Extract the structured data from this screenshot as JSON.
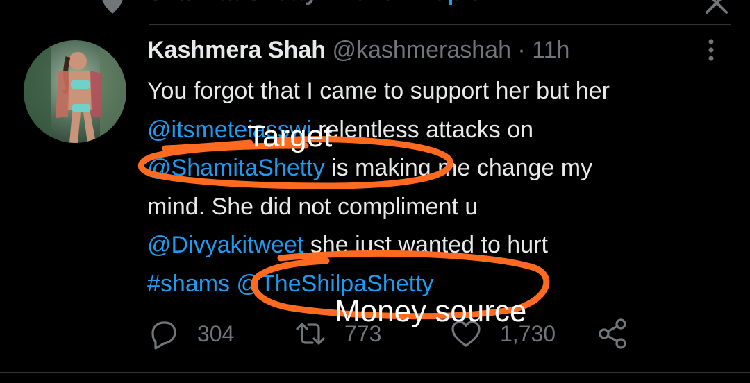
{
  "topic_bar": {
    "topic_name": "Shamita Shetty",
    "separator": " · ",
    "follow_label": "Follow Topic"
  },
  "tweet": {
    "author_name": "Kashmera Shah",
    "author_handle": "@kashmerashah",
    "dot": " · ",
    "time": "11h",
    "lines": [
      [
        {
          "t": "You forgot that I came to support her but her",
          "link": false
        }
      ],
      [
        {
          "t": "@itsmeteiasswi",
          "link": true
        },
        {
          "t": " relentless attacks on",
          "link": false
        }
      ],
      [
        {
          "t": "@ShamitaShetty",
          "link": true
        },
        {
          "t": " is making me change my",
          "link": false
        }
      ],
      [
        {
          "t": "mind. She did not compliment u",
          "link": false
        }
      ],
      [
        {
          "t": "@Divyakitweet",
          "link": true
        },
        {
          "t": " she just wanted to hurt",
          "link": false
        }
      ],
      [
        {
          "t": "#shams",
          "link": true
        },
        {
          "t": " ",
          "link": false
        },
        {
          "t": "@TheShilpaShetty",
          "link": true
        }
      ]
    ]
  },
  "actions": {
    "reply_count": "304",
    "retweet_count": "773",
    "like_count": "1,730"
  },
  "annotations": {
    "target_label": "Target",
    "money_label": "Money source",
    "scribble_color": "#ff6a21"
  },
  "colors": {
    "background": "#000000",
    "text": "#e7e9ea",
    "muted": "#71767b",
    "link": "#1d9bf0"
  }
}
